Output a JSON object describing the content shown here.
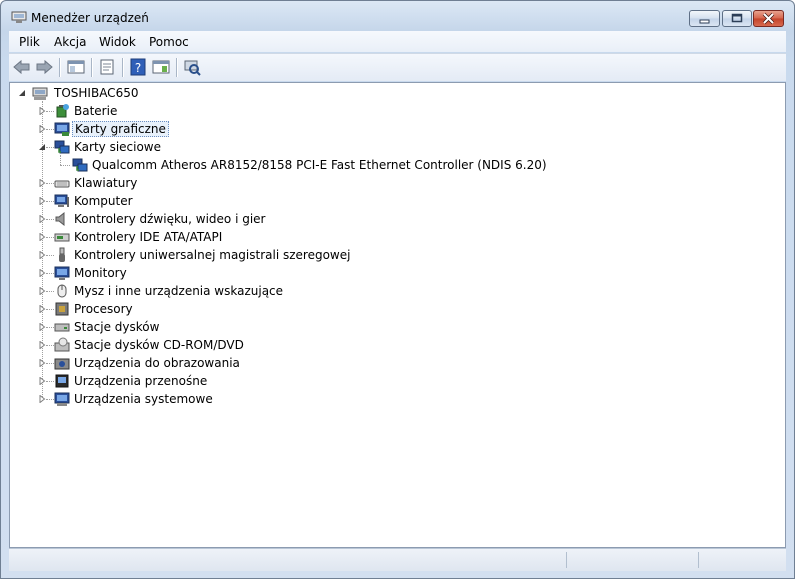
{
  "window": {
    "title": "Menedżer urządzeń"
  },
  "menu": {
    "items": [
      "Plik",
      "Akcja",
      "Widok",
      "Pomoc"
    ]
  },
  "toolbar": {
    "buttons": [
      "back-icon",
      "forward-icon",
      "show-hide-console-tree-icon",
      "properties-icon",
      "help-icon",
      "show-action-pane-icon",
      "scan-hardware-changes-icon"
    ]
  },
  "tree": {
    "root": "TOSHIBAC650",
    "items": [
      {
        "label": "Baterie",
        "icon": "battery-icon",
        "expanded": false
      },
      {
        "label": "Karty graficzne",
        "icon": "display-adapter-icon",
        "expanded": false,
        "selected": true
      },
      {
        "label": "Karty sieciowe",
        "icon": "network-adapter-icon",
        "expanded": true,
        "children": [
          {
            "label": "Qualcomm Atheros AR8152/8158 PCI-E Fast Ethernet Controller (NDIS 6.20)",
            "icon": "network-adapter-icon"
          }
        ]
      },
      {
        "label": "Klawiatury",
        "icon": "keyboard-icon",
        "expanded": false
      },
      {
        "label": "Komputer",
        "icon": "computer-icon",
        "expanded": false
      },
      {
        "label": "Kontrolery dźwięku, wideo i gier",
        "icon": "speaker-icon",
        "expanded": false
      },
      {
        "label": "Kontrolery IDE ATA/ATAPI",
        "icon": "ide-controller-icon",
        "expanded": false
      },
      {
        "label": "Kontrolery uniwersalnej magistrali szeregowej",
        "icon": "usb-icon",
        "expanded": false
      },
      {
        "label": "Monitory",
        "icon": "monitor-icon",
        "expanded": false
      },
      {
        "label": "Mysz i inne urządzenia wskazujące",
        "icon": "mouse-icon",
        "expanded": false
      },
      {
        "label": "Procesory",
        "icon": "processor-icon",
        "expanded": false
      },
      {
        "label": "Stacje dysków",
        "icon": "disk-drive-icon",
        "expanded": false
      },
      {
        "label": "Stacje dysków CD-ROM/DVD",
        "icon": "cdrom-icon",
        "expanded": false
      },
      {
        "label": "Urządzenia do obrazowania",
        "icon": "camera-icon",
        "expanded": false
      },
      {
        "label": "Urządzenia przenośne",
        "icon": "portable-device-icon",
        "expanded": false
      },
      {
        "label": "Urządzenia systemowe",
        "icon": "system-device-icon",
        "expanded": false
      }
    ]
  },
  "colors": {
    "selection_border": "#6b8fc2",
    "close_button": "#c34229",
    "frame": "#c5d6ea"
  }
}
